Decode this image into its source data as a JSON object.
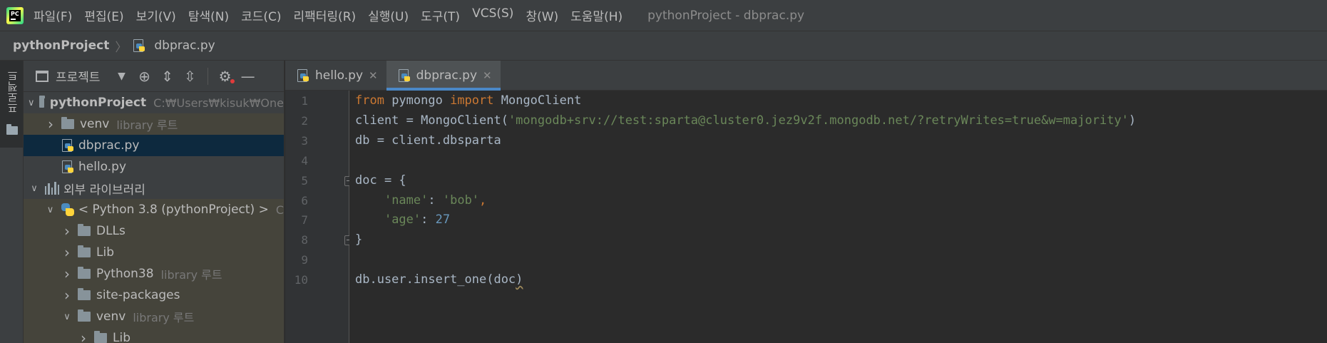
{
  "menubar": {
    "items": [
      "파일(F)",
      "편집(E)",
      "보기(V)",
      "탐색(N)",
      "코드(C)",
      "리팩터링(R)",
      "실행(U)",
      "도구(T)",
      "VCS(S)",
      "창(W)",
      "도움말(H)"
    ],
    "window_title": "pythonProject - dbprac.py",
    "logo_text": "PC"
  },
  "breadcrumb": {
    "project": "pythonProject",
    "file": "dbprac.py"
  },
  "tool_stripe": {
    "project_label": "프로젝트"
  },
  "project_panel": {
    "title": "프로젝트",
    "tree": [
      {
        "label": "pythonProject",
        "hint": "C:₩Users₩kisuk₩One",
        "depth": 0,
        "kind": "folder",
        "expanded": true,
        "bold": true
      },
      {
        "label": "venv",
        "hint": "library 루트",
        "depth": 1,
        "kind": "folder",
        "expanded": false,
        "lib": true
      },
      {
        "label": "dbprac.py",
        "hint": "",
        "depth": 1,
        "kind": "py",
        "selected": true
      },
      {
        "label": "hello.py",
        "hint": "",
        "depth": 1,
        "kind": "py"
      },
      {
        "label": "외부 라이브러리",
        "hint": "",
        "depth": 0,
        "kind": "libs",
        "expanded": true
      },
      {
        "label": "< Python 3.8 (pythonProject) >",
        "hint": "C",
        "depth": 1,
        "kind": "python",
        "expanded": true,
        "lib": true
      },
      {
        "label": "DLLs",
        "hint": "",
        "depth": 2,
        "kind": "folder",
        "expanded": false,
        "lib": true
      },
      {
        "label": "Lib",
        "hint": "",
        "depth": 2,
        "kind": "folder",
        "expanded": false,
        "lib": true
      },
      {
        "label": "Python38",
        "hint": "library 루트",
        "depth": 2,
        "kind": "folder",
        "expanded": false,
        "lib": true
      },
      {
        "label": "site-packages",
        "hint": "",
        "depth": 2,
        "kind": "folder",
        "expanded": false,
        "lib": true
      },
      {
        "label": "venv",
        "hint": "library 루트",
        "depth": 2,
        "kind": "folder",
        "expanded": true,
        "lib": true
      },
      {
        "label": "Lib",
        "hint": "",
        "depth": 3,
        "kind": "folder",
        "expanded": false,
        "lib": true
      }
    ]
  },
  "editor": {
    "tabs": [
      {
        "label": "hello.py",
        "active": false
      },
      {
        "label": "dbprac.py",
        "active": true
      }
    ],
    "code_lines": [
      {
        "n": "1",
        "tokens": [
          [
            "kw",
            "from"
          ],
          [
            "plain",
            " pymongo "
          ],
          [
            "kw",
            "import"
          ],
          [
            "plain",
            " MongoClient"
          ]
        ]
      },
      {
        "n": "2",
        "tokens": [
          [
            "plain",
            "client = MongoClient("
          ],
          [
            "str",
            "'mongodb+srv://test:sparta@cluster0.jez9v2f.mongodb.net/?retryWrites=true&w=majority'"
          ],
          [
            "plain",
            ")"
          ]
        ]
      },
      {
        "n": "3",
        "tokens": [
          [
            "plain",
            "db = client.dbsparta"
          ]
        ]
      },
      {
        "n": "4",
        "tokens": []
      },
      {
        "n": "5",
        "tokens": [
          [
            "plain",
            "doc = {"
          ]
        ],
        "fold": true
      },
      {
        "n": "6",
        "tokens": [
          [
            "plain",
            "    "
          ],
          [
            "str",
            "'name'"
          ],
          [
            "plain",
            ": "
          ],
          [
            "str",
            "'bob'"
          ],
          [
            "kw",
            ","
          ]
        ]
      },
      {
        "n": "7",
        "tokens": [
          [
            "plain",
            "    "
          ],
          [
            "str",
            "'age'"
          ],
          [
            "plain",
            ": "
          ],
          [
            "num",
            "27"
          ]
        ]
      },
      {
        "n": "8",
        "tokens": [
          [
            "plain",
            "}"
          ]
        ],
        "fold": true
      },
      {
        "n": "9",
        "tokens": []
      },
      {
        "n": "10",
        "tokens": [
          [
            "plain",
            "db.user.insert_one(doc"
          ],
          [
            "squig",
            ")"
          ]
        ]
      }
    ]
  }
}
